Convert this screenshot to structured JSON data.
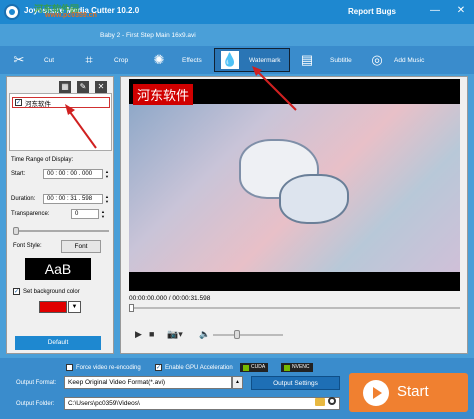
{
  "window": {
    "title": "Joyoshare Media Cutter 10.2.0",
    "report_bugs": "Report Bugs",
    "minimize": "—",
    "close": "✕",
    "watermark_overlay": "河东软件园",
    "watermark_sub": "www.pc0359.cn",
    "file_name": "Baby 2 - First Step Main 16x9.avi"
  },
  "tabs": [
    {
      "label": "Cut",
      "icon": "scissors-icon"
    },
    {
      "label": "Crop",
      "icon": "crop-icon"
    },
    {
      "label": "Effects",
      "icon": "effects-icon"
    },
    {
      "label": "Watermark",
      "icon": "watermark-icon",
      "active": true
    },
    {
      "label": "Subtitle",
      "icon": "subtitle-icon"
    },
    {
      "label": "Add Music",
      "icon": "music-icon"
    }
  ],
  "left_panel": {
    "watermark_items": [
      {
        "label": "河东软件",
        "checked": true
      }
    ],
    "time_range_label": "Time Range of Display:",
    "start_label": "Start:",
    "start_value": "00 : 00 : 00 . 000",
    "duration_label": "Duration:",
    "duration_value": "00 : 00 : 31 . 598",
    "transparence_label": "Transparence:",
    "transparence_value": "0",
    "font_style_label": "Font Style:",
    "font_button": "Font",
    "font_preview": "AaB",
    "set_bg_color_label": "Set background color",
    "bg_color": "#e00000",
    "default_button": "Default"
  },
  "preview": {
    "watermark_text": "河东软件",
    "timecode": "00:00:00.000 / 00:00:31.598"
  },
  "bottom": {
    "force_reencode": "Force video re-encoding",
    "gpu_accel": "Enable GPU Acceleration",
    "cuda_badge": "CUDA",
    "nvenc_badge": "NVENC",
    "output_format_label": "Output Format:",
    "output_format_value": "Keep Original Video Format(*.avi)",
    "output_settings": "Output Settings",
    "output_folder_label": "Output Folder:",
    "output_folder_value": "C:\\Users\\pc0359\\Videos\\",
    "start_button": "Start"
  },
  "colors": {
    "accent": "#1e88d0",
    "start": "#f08030",
    "annotation_arrow": "#d02020"
  }
}
